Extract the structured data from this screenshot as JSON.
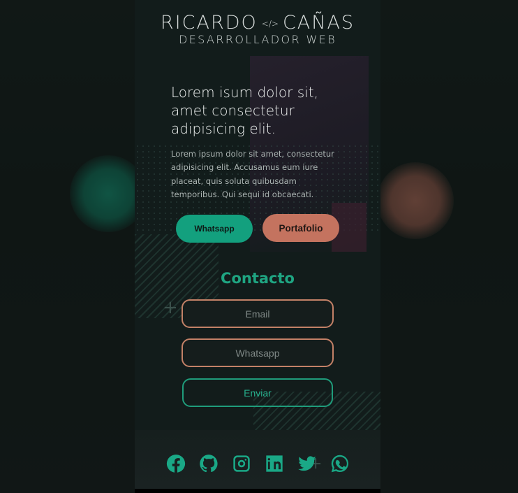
{
  "brand": {
    "name_left": "RICARDO",
    "code_glyph": "</>",
    "name_right": "CAÑAS",
    "subtitle": "DESARROLLADOR WEB"
  },
  "hero": {
    "headline": "Lorem isum dolor sit, amet consectetur adipisicing elit.",
    "body": "Lorem ipsum dolor sit amet, consectetur adipisicing elit. Accusamus eum iure placeat, quis soluta quibusdam temporibus. Qui sequi id obcaecati.",
    "whatsapp_label": "Whatsapp",
    "portfolio_label": "Portafolio"
  },
  "contact": {
    "title": "Contacto",
    "email_placeholder": "Email",
    "whatsapp_placeholder": "Whatsapp",
    "send_label": "Enviar"
  },
  "socials": [
    {
      "icon": "facebook-icon"
    },
    {
      "icon": "github-icon"
    },
    {
      "icon": "instagram-icon"
    },
    {
      "icon": "linkedin-icon"
    },
    {
      "icon": "twitter-icon"
    },
    {
      "icon": "whatsapp-icon"
    }
  ],
  "colors": {
    "accent_green": "#13a07e",
    "accent_salmon": "#c4735f",
    "background": "#121c1b"
  }
}
